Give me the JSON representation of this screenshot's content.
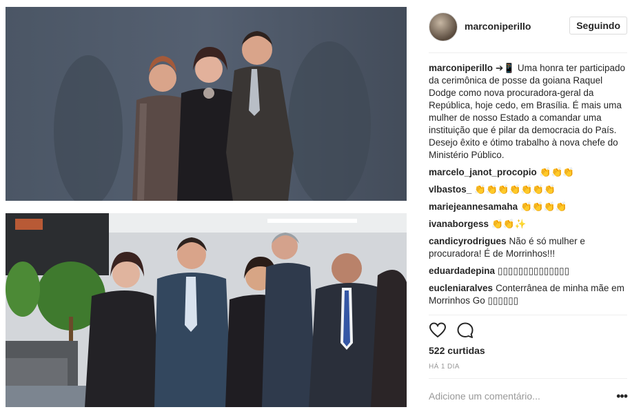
{
  "post": {
    "username": "marconiperillo",
    "follow_label": "Seguindo",
    "caption_user": "marconiperillo",
    "caption_text": "➔📱 Uma honra ter participado da cerimônica de posse da goiana Raquel Dodge como nova procuradora-geral da República, hoje cedo, em Brasília. É mais uma mulher de nosso Estado a comandar uma instituição que é pilar da democracia do País. Desejo êxito e ótimo trabalho à nova chefe do Ministério Público.",
    "comments": [
      {
        "user": "marcelo_janot_procopio",
        "text": "👏👏👏"
      },
      {
        "user": "vlbastos_",
        "text": "👏👏👏👏👏👏👏"
      },
      {
        "user": "mariejeannesamaha",
        "text": "👏👏👏👏"
      },
      {
        "user": "ivanaborgess",
        "text": "👏👏✨"
      },
      {
        "user": "candicyrodrigues",
        "text": "Não é só mulher e procuradora! É de Morrinhos!!!"
      },
      {
        "user": "eduardadepina",
        "text": "▯▯▯▯▯▯▯▯▯▯▯▯▯▯"
      },
      {
        "user": "eucleniaralves",
        "text": "Conterrânea de minha mãe em Morrinhos Go ▯▯▯▯▯▯"
      }
    ],
    "likes": "522 curtidas",
    "time": "HÁ 1 DIA",
    "comment_placeholder": "Adicione um comentário..."
  },
  "icons": {
    "like": "heart-icon",
    "comment": "comment-bubble-icon",
    "more": "more-options-icon"
  }
}
